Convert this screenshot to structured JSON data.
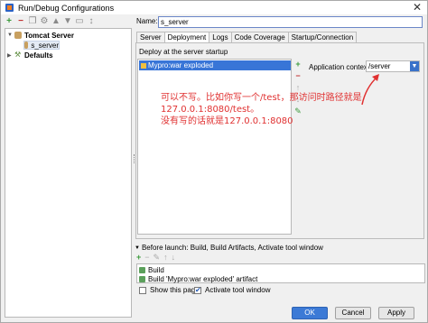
{
  "window": {
    "title": "Run/Debug Configurations"
  },
  "left_toolbar": {
    "icons": [
      "add-icon",
      "remove-icon",
      "copy-icon",
      "settings-icon",
      "move-up-icon",
      "move-down-icon",
      "folder-icon",
      "sort-icon"
    ]
  },
  "tree": {
    "group": "Tomcat Server",
    "item": "s_server",
    "defaults": "Defaults"
  },
  "name": {
    "label": "Name:",
    "value": "s_server"
  },
  "tabs": [
    "Server",
    "Deployment",
    "Logs",
    "Code Coverage",
    "Startup/Connection"
  ],
  "active_tab": "Deployment",
  "deployment": {
    "label": "Deploy at the server startup",
    "artifacts": [
      "Mypro:war exploded"
    ],
    "context_label": "Application context:",
    "context_value": "/server"
  },
  "annotation": {
    "line1": "可以不写。比如你写一个/test，那访问时路径就是127.0.0.1:8080/test。",
    "line2": "没有写的话就是127.0.0.1:8080",
    "color": "#e03030"
  },
  "before_launch": {
    "label": "Before launch: Build, Build Artifacts, Activate tool window",
    "items": [
      "Build",
      "Build 'Mypro:war exploded' artifact"
    ]
  },
  "options": {
    "show_page": {
      "label": "Show this page",
      "checked": false
    },
    "activate_window": {
      "label": "Activate tool window",
      "checked": true
    }
  },
  "buttons": {
    "ok": "OK",
    "cancel": "Cancel",
    "apply": "Apply"
  }
}
